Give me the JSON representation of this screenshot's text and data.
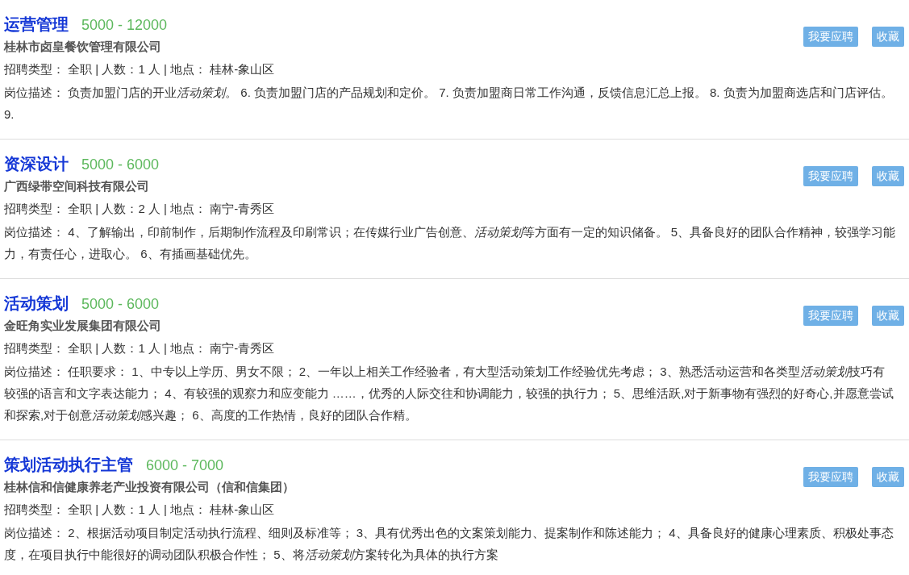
{
  "jobs": [
    {
      "title": "运营管理",
      "salary": "5000 - 12000",
      "company": "桂林市卤皇餐饮管理有限公司",
      "meta": "招聘类型： 全职 | 人数：1 人 | 地点： 桂林-象山区",
      "description": [
        {
          "text": "岗位描述： 负责加盟门店的开业",
          "italic": false
        },
        {
          "text": "活动策划",
          "italic": true
        },
        {
          "text": "。 6. 负责加盟门店的产品规划和定价。 7. 负责加盟商日常工作沟通，反馈信息汇总上报。 8. 负责为加盟商选店和门店评估。 9.",
          "italic": false
        }
      ],
      "apply": "我要应聘",
      "save": "收藏"
    },
    {
      "title": "资深设计",
      "salary": "5000 - 6000",
      "company": "广西绿带空间科技有限公司",
      "meta": "招聘类型： 全职 | 人数：2 人 | 地点： 南宁-青秀区",
      "description": [
        {
          "text": "岗位描述： 4、了解输出，印前制作，后期制作流程及印刷常识；在传媒行业广告创意、",
          "italic": false
        },
        {
          "text": "活动策划",
          "italic": true
        },
        {
          "text": "等方面有一定的知识储备。 5、具备良好的团队合作精神，较强学习能力，有责任心，进取心。 6、有插画基础优先。",
          "italic": false
        }
      ],
      "apply": "我要应聘",
      "save": "收藏"
    },
    {
      "title": "活动策划",
      "salary": "5000 - 6000",
      "company": "金旺角实业发展集团有限公司",
      "meta": "招聘类型： 全职 | 人数：1 人 | 地点： 南宁-青秀区",
      "description": [
        {
          "text": "岗位描述： 任职要求： 1、中专以上学历、男女不限； 2、一年以上相关工作经验者，有大型活动策划工作经验优先考虑； 3、熟悉活动运营和各类型",
          "italic": false
        },
        {
          "text": "活动策划",
          "italic": true
        },
        {
          "text": "技巧有较强的语言和文字表达能力； 4、有较强的观察力和应变能力 ……，优秀的人际交往和协调能力，较强的执行力； 5、思维活跃,对于新事物有强烈的好奇心,并愿意尝试和探索,对于创意",
          "italic": false
        },
        {
          "text": "活动策划",
          "italic": true
        },
        {
          "text": "感兴趣； 6、高度的工作热情，良好的团队合作精。",
          "italic": false
        }
      ],
      "apply": "我要应聘",
      "save": "收藏"
    },
    {
      "title": "策划活动执行主管",
      "salary": "6000 - 7000",
      "company": "桂林信和信健康养老产业投资有限公司（信和信集团）",
      "meta": "招聘类型： 全职 | 人数：1 人 | 地点： 桂林-象山区",
      "description": [
        {
          "text": "岗位描述： 2、根据活动项目制定活动执行流程、细则及标准等； 3、具有优秀出色的文案策划能力、提案制作和陈述能力； 4、具备良好的健康心理素质、积极处事态度，在项目执行中能很好的调动团队积极合作性； 5、将",
          "italic": false
        },
        {
          "text": "活动策划",
          "italic": true
        },
        {
          "text": "方案转化为具体的执行方案",
          "italic": false
        }
      ],
      "apply": "我要应聘",
      "save": "收藏"
    }
  ]
}
